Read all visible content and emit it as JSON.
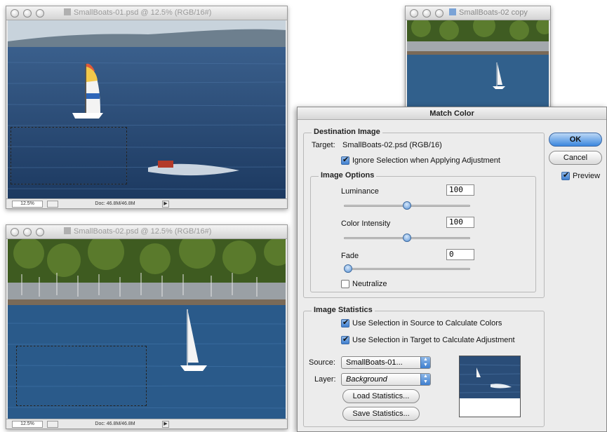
{
  "windows": {
    "doc1": {
      "title": "SmallBoats-01.psd @ 12.5% (RGB/16#)",
      "zoom": "12.5%",
      "doc_size": "Doc: 46.8M/46.8M"
    },
    "doc2": {
      "title": "SmallBoats-02.psd @ 12.5% (RGB/16#)",
      "zoom": "12.5%",
      "doc_size": "Doc: 46.8M/46.8M"
    },
    "doc3": {
      "title": "SmallBoats-02 copy"
    }
  },
  "dialog": {
    "title": "Match Color",
    "destination": {
      "group_label": "Destination Image",
      "target_label": "Target:",
      "target_value": "SmallBoats-02.psd (RGB/16)",
      "ignore_selection_label": "Ignore Selection when Applying Adjustment",
      "ignore_selection_checked": true
    },
    "image_options": {
      "group_label": "Image Options",
      "luminance_label": "Luminance",
      "luminance_value": "100",
      "luminance_level": 0.5,
      "color_intensity_label": "Color Intensity",
      "color_intensity_value": "100",
      "color_intensity_level": 0.5,
      "fade_label": "Fade",
      "fade_value": "0",
      "fade_level": 0,
      "neutralize_label": "Neutralize",
      "neutralize_checked": false
    },
    "image_statistics": {
      "group_label": "Image Statistics",
      "use_source_label": "Use Selection in Source to Calculate Colors",
      "use_source_checked": true,
      "use_target_label": "Use Selection in Target to Calculate Adjustment",
      "use_target_checked": true,
      "source_label": "Source:",
      "source_value": "SmallBoats-01...",
      "layer_label": "Layer:",
      "layer_value": "Background",
      "load_button": "Load Statistics...",
      "save_button": "Save Statistics..."
    },
    "buttons": {
      "ok": "OK",
      "cancel": "Cancel",
      "preview_label": "Preview",
      "preview_checked": true
    }
  },
  "colors": {
    "water": "#2a4d78",
    "water_dark": "#1d3a5f",
    "sky": "#c4d1dc",
    "trees": "#3d5a1e",
    "accent": "#3b87de"
  }
}
